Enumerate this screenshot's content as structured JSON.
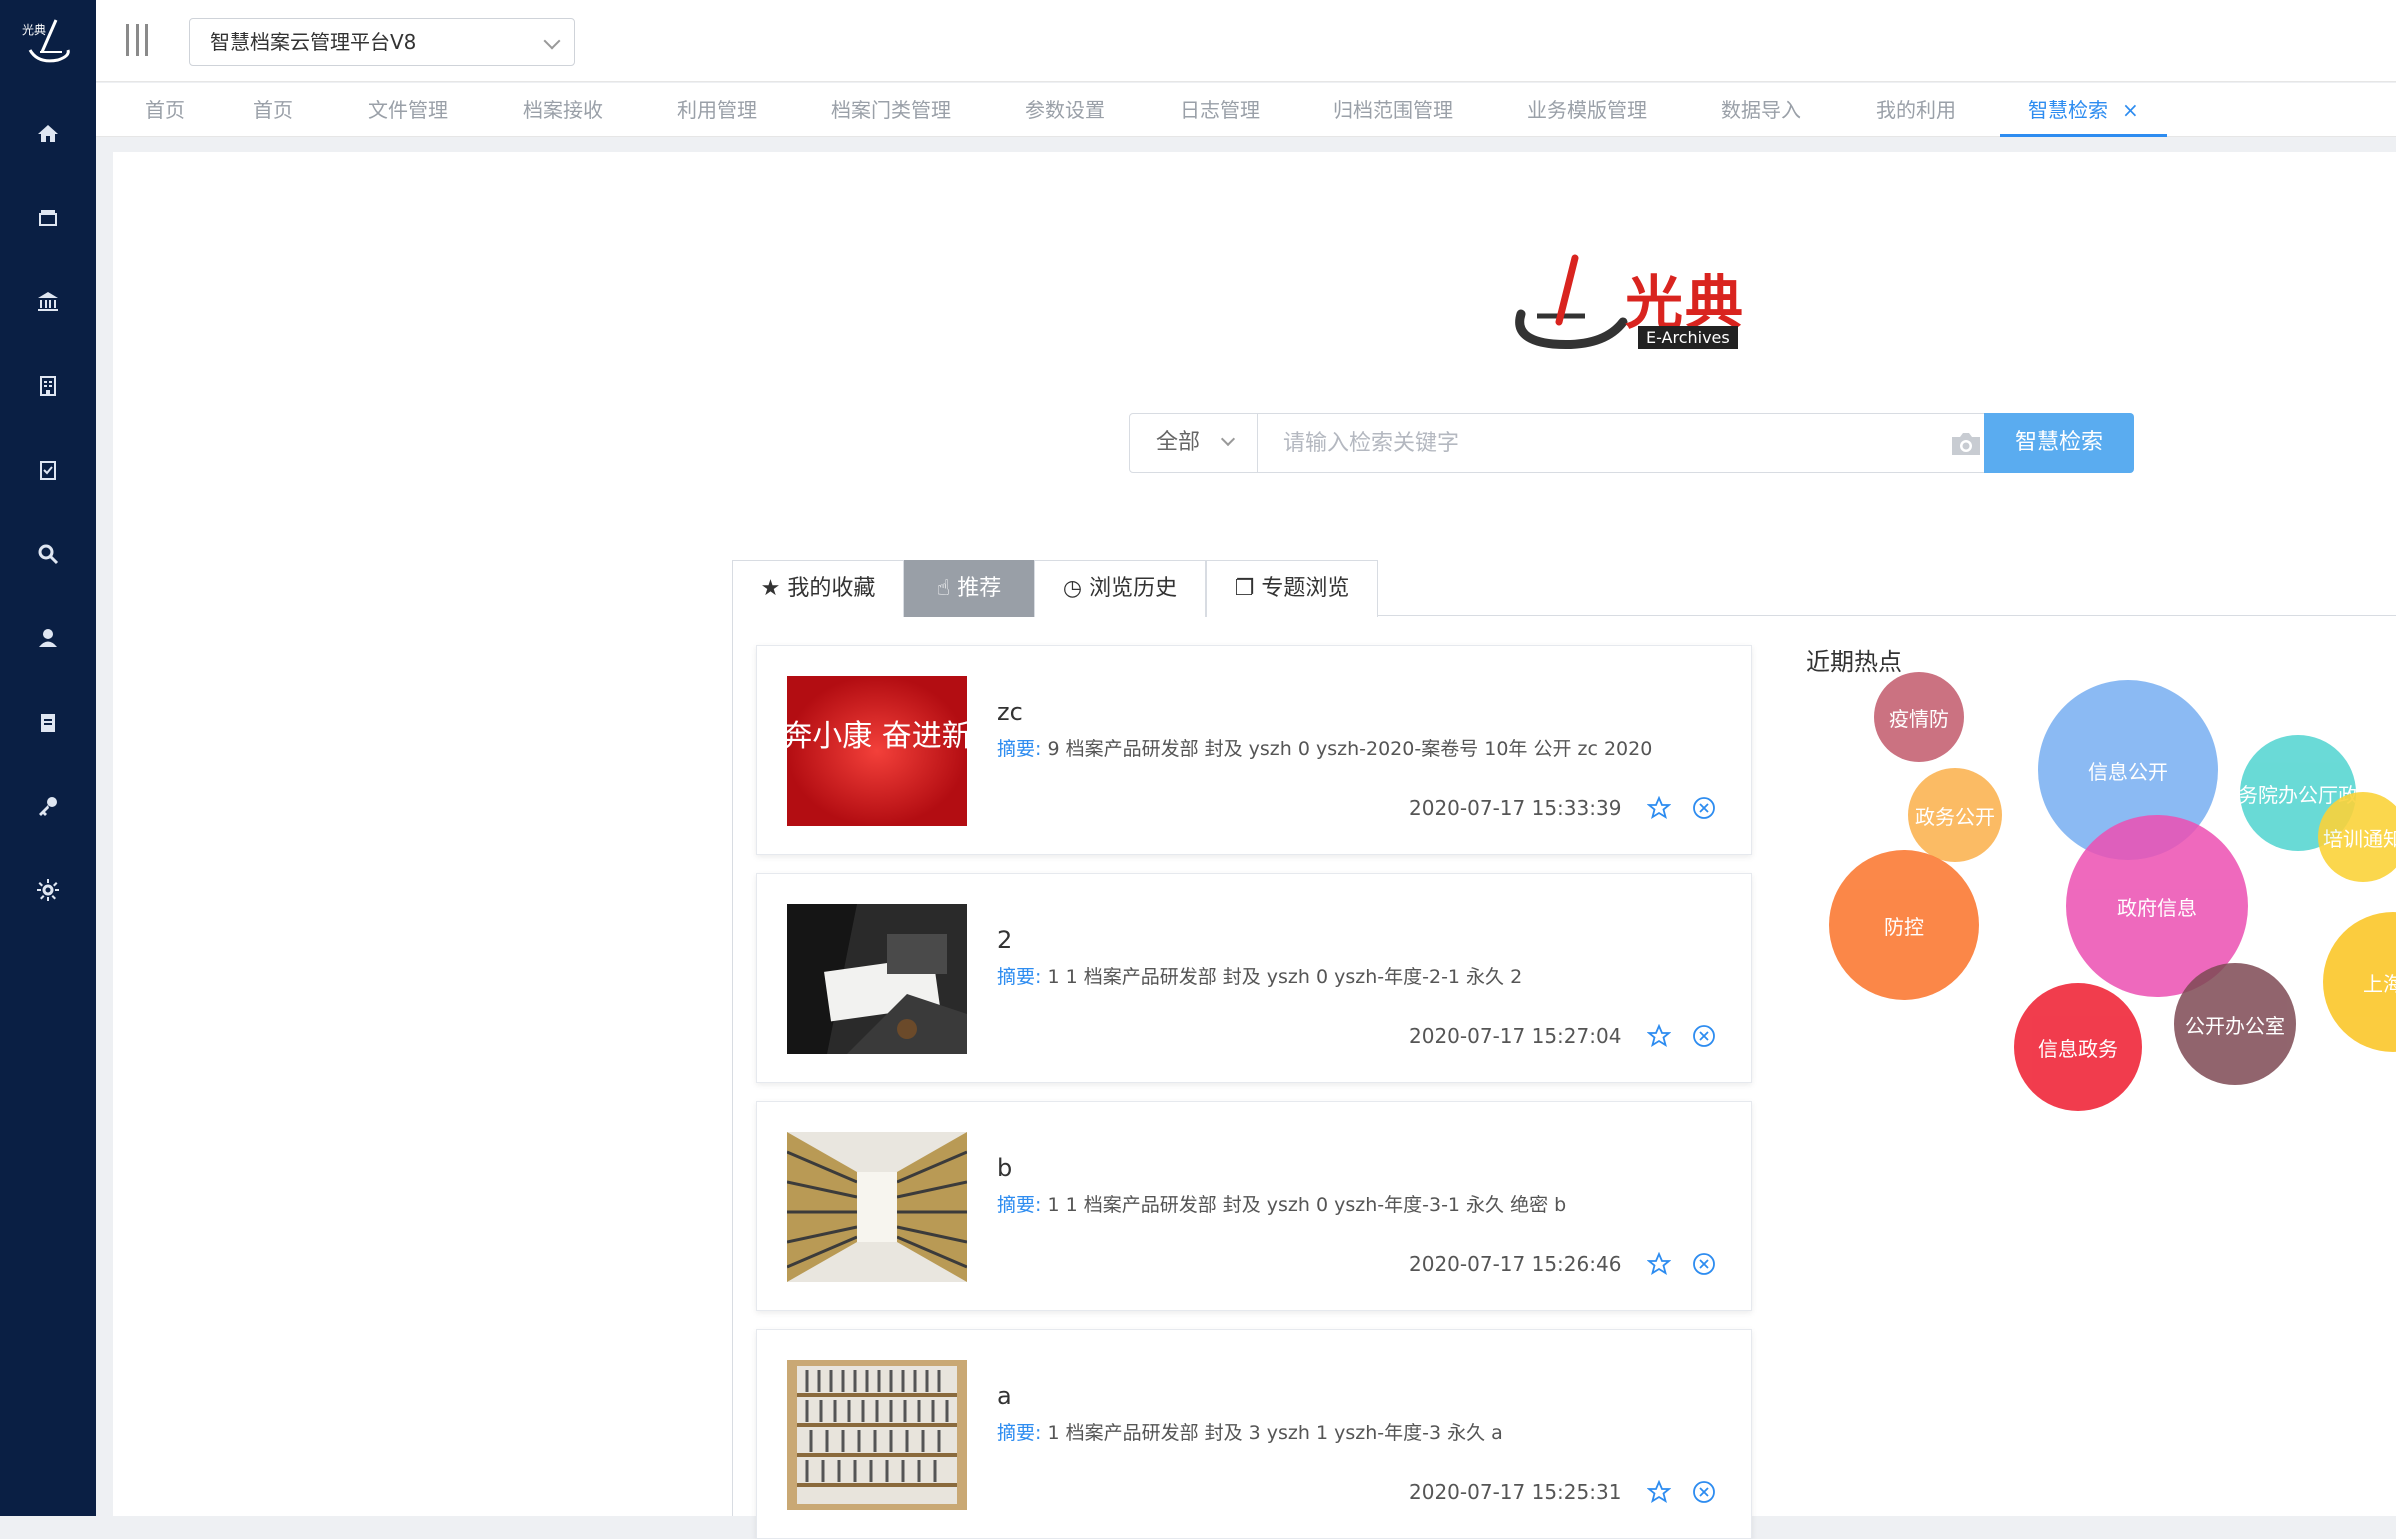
{
  "sidebar": {
    "logo_text": "光典",
    "items": [
      {
        "name": "home",
        "icon": "home-icon"
      },
      {
        "name": "layers",
        "icon": "layers-icon"
      },
      {
        "name": "institution",
        "icon": "bank-icon"
      },
      {
        "name": "building",
        "icon": "building-icon"
      },
      {
        "name": "task",
        "icon": "clipboard-check-icon"
      },
      {
        "name": "search",
        "icon": "search-icon"
      },
      {
        "name": "user",
        "icon": "user-icon"
      },
      {
        "name": "document",
        "icon": "document-icon"
      },
      {
        "name": "key",
        "icon": "key-icon"
      },
      {
        "name": "settings",
        "icon": "gear-icon"
      }
    ]
  },
  "header": {
    "platform": "智慧档案云管理平台V8"
  },
  "tabs": [
    {
      "label": "首页"
    },
    {
      "label": "首页"
    },
    {
      "label": "文件管理"
    },
    {
      "label": "档案接收"
    },
    {
      "label": "利用管理"
    },
    {
      "label": "档案门类管理"
    },
    {
      "label": "参数设置"
    },
    {
      "label": "日志管理"
    },
    {
      "label": "归档范围管理"
    },
    {
      "label": "业务模版管理"
    },
    {
      "label": "数据导入"
    },
    {
      "label": "我的利用"
    },
    {
      "label": "智慧检索",
      "close": "×"
    }
  ],
  "brand": {
    "name": "光典",
    "tag": "E-Archives"
  },
  "search": {
    "scope": "全部",
    "placeholder": "请输入检索关键字",
    "button": "智慧检索"
  },
  "content_tabs": [
    {
      "label": "我的收藏",
      "icon": "★"
    },
    {
      "label": "推荐",
      "icon": "☝"
    },
    {
      "label": "浏览历史",
      "icon": "◷"
    },
    {
      "label": "专题浏览",
      "icon": "❐"
    }
  ],
  "cards": [
    {
      "title": "zc",
      "summary_label": "摘要:",
      "summary": "9 档案产品研发部 封及 yszh 0 yszh-2020-案卷号 10年 公开 zc 2020",
      "date": "2020-07-17 15:33:39",
      "thumb_text": "同心奔小康 奋进新时代"
    },
    {
      "title": "2",
      "summary_label": "摘要:",
      "summary": "1 1 档案产品研发部 封及 yszh 0 yszh-年度-2-1 永久 2",
      "date": "2020-07-17 15:27:04"
    },
    {
      "title": "b",
      "summary_label": "摘要:",
      "summary": "1 1 档案产品研发部 封及 yszh 0 yszh-年度-3-1 永久 绝密 b",
      "date": "2020-07-17 15:26:46"
    },
    {
      "title": "a",
      "summary_label": "摘要:",
      "summary": "1 档案产品研发部 封及 3 yszh 1 yszh-年度-3 永久 a",
      "date": "2020-07-17 15:25:31"
    }
  ],
  "hot": {
    "title": "近期热点",
    "bubbles": [
      {
        "label": "疫情防",
        "color": "#c25a6c"
      },
      {
        "label": "信息公开",
        "color": "#7fb3f2"
      },
      {
        "label": "务院办公厅政",
        "color": "#50d4d0"
      },
      {
        "label": "政务公开",
        "color": "#fbb04a"
      },
      {
        "label": "培训通知",
        "color": "#fbd33a"
      },
      {
        "label": "政府信息",
        "color": "#ec4fb2"
      },
      {
        "label": "防控",
        "color": "#fb7b35"
      },
      {
        "label": "上海市",
        "color": "#fbc72a"
      },
      {
        "label": "公开办公室",
        "color": "#7e4a54"
      },
      {
        "label": "信息政务",
        "color": "#f0283a"
      }
    ]
  }
}
